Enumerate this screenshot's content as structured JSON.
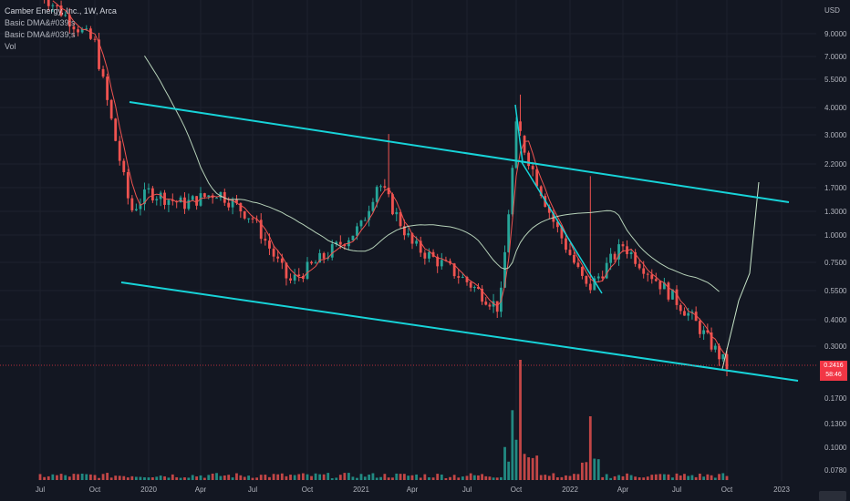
{
  "legend": {
    "title": "Camber Energy, Inc., 1W, Arca",
    "indicators": [
      "Basic DMA&#039;s",
      "Basic DMA&#039;s",
      "Vol"
    ]
  },
  "axis": {
    "currency": "USD",
    "price_ticks": [
      "9.0000",
      "7.0000",
      "5.5000",
      "4.0000",
      "3.0000",
      "2.2000",
      "1.7000",
      "1.3000",
      "1.0000",
      "0.7500",
      "0.5500",
      "0.4000",
      "0.3000"
    ],
    "volume_ticks": [
      "0.1700",
      "0.1300",
      "0.1000",
      "0.0780"
    ],
    "time_ticks": [
      "Jul",
      "Oct",
      "2020",
      "Apr",
      "Jul",
      "Oct",
      "2021",
      "Apr",
      "Jul",
      "Oct",
      "2022",
      "Apr",
      "Jul",
      "Oct",
      "2023"
    ]
  },
  "last_price": {
    "value": "0.2416",
    "countdown": "58:46"
  },
  "colors": {
    "background": "#131722",
    "up": "#26a69a",
    "down": "#ef5350",
    "channel": "#17d3d8",
    "ma_fast": "#ef5350",
    "ma_slow": "#c8e6c9",
    "grid": "#1e222d",
    "text": "#b2b5be",
    "tag": "#f23645"
  },
  "chart_data": {
    "type": "candlestick",
    "symbol": "Camber Energy, Inc.",
    "interval": "1W",
    "exchange": "Arca",
    "y_scale": "log",
    "close_path": [
      {
        "date": "2019-07",
        "close": 14.0
      },
      {
        "date": "2019-10",
        "close": 8.0
      },
      {
        "date": "2019-12",
        "close": 1.3
      },
      {
        "date": "2020-01",
        "close": 1.6
      },
      {
        "date": "2020-03",
        "close": 1.4
      },
      {
        "date": "2020-05",
        "close": 1.6
      },
      {
        "date": "2020-07",
        "close": 1.2
      },
      {
        "date": "2020-09",
        "close": 0.6
      },
      {
        "date": "2020-11",
        "close": 0.8
      },
      {
        "date": "2021-01",
        "close": 1.1
      },
      {
        "date": "2021-02",
        "close": 1.8
      },
      {
        "date": "2021-04",
        "close": 0.9
      },
      {
        "date": "2021-06",
        "close": 0.7
      },
      {
        "date": "2021-09",
        "close": 0.45
      },
      {
        "date": "2021-10",
        "close": 3.2
      },
      {
        "date": "2021-12",
        "close": 1.2
      },
      {
        "date": "2022-02",
        "close": 0.55
      },
      {
        "date": "2022-04",
        "close": 0.9
      },
      {
        "date": "2022-06",
        "close": 0.6
      },
      {
        "date": "2022-08",
        "close": 0.4
      },
      {
        "date": "2022-10",
        "close": 0.2416
      }
    ]
  }
}
